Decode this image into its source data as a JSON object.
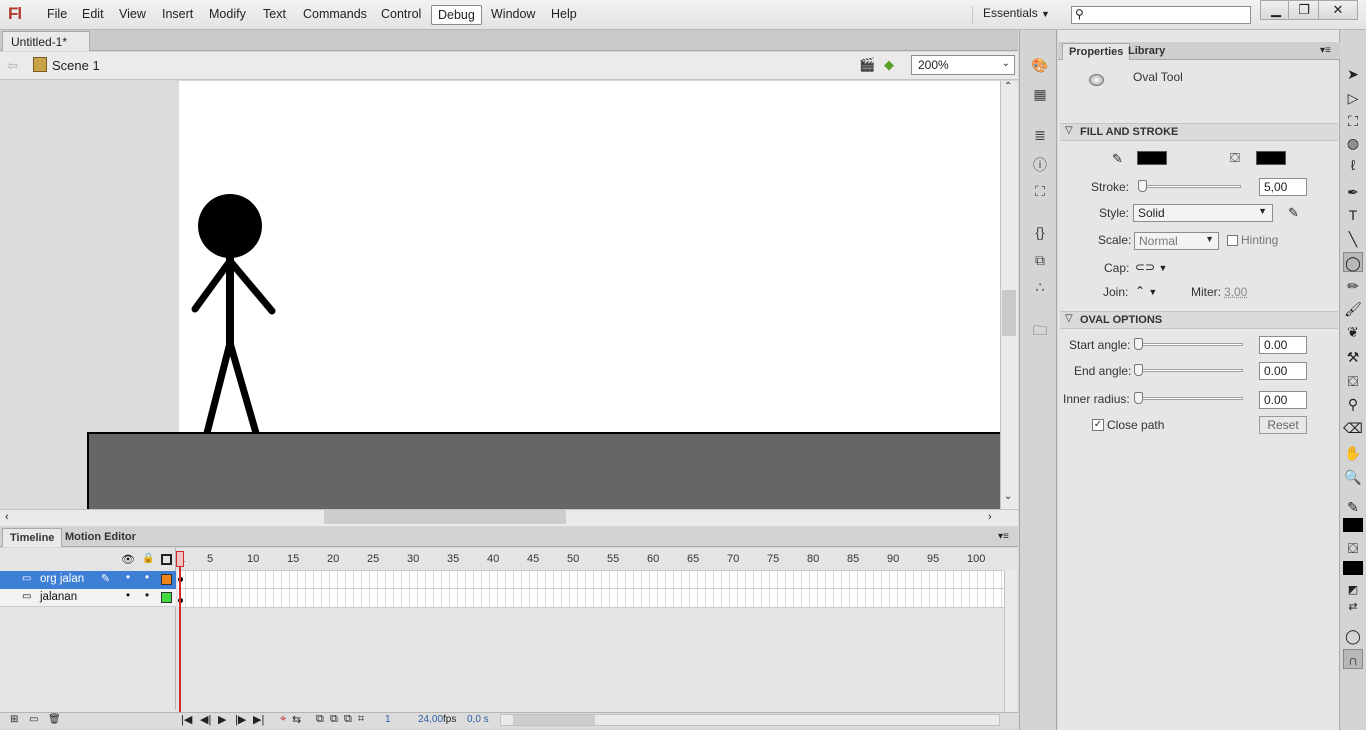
{
  "app": {
    "logo": "Fl"
  },
  "menu": [
    "File",
    "Edit",
    "View",
    "Insert",
    "Modify",
    "Text",
    "Commands",
    "Control",
    "Debug",
    "Window",
    "Help"
  ],
  "workspace": {
    "label": "Essentials"
  },
  "window_controls": {
    "minimize": "▁",
    "restore": "❐",
    "close": "✕"
  },
  "document": {
    "tab_title": "Untitled-1*",
    "scene": "Scene 1",
    "zoom": "200%"
  },
  "timeline": {
    "tabs": [
      "Timeline",
      "Motion Editor"
    ],
    "layers": [
      {
        "name": "org jalan",
        "color": "#f0861a",
        "selected": true
      },
      {
        "name": "jalanan",
        "color": "#3fdc3f",
        "selected": false
      }
    ],
    "ruler": [
      "1",
      "5",
      "10",
      "15",
      "20",
      "25",
      "30",
      "35",
      "40",
      "45",
      "50",
      "55",
      "60",
      "65",
      "70",
      "75",
      "80",
      "85",
      "90",
      "95",
      "100"
    ],
    "status": {
      "frame": "1",
      "fps": "24,00",
      "fps_unit": "fps",
      "time": "0,0 s"
    }
  },
  "properties": {
    "tabs": [
      "Properties",
      "Library"
    ],
    "tool_name": "Oval Tool",
    "fill_stroke": {
      "header": "FILL AND STROKE",
      "stroke_label": "Stroke:",
      "stroke_value": "5,00",
      "style_label": "Style:",
      "style_value": "Solid",
      "scale_label": "Scale:",
      "scale_value": "Normal",
      "hinting_label": "Hinting",
      "cap_label": "Cap:",
      "join_label": "Join:",
      "miter_label": "Miter:",
      "miter_value": "3,00",
      "stroke_color": "#000000",
      "fill_color": "#000000"
    },
    "oval_options": {
      "header": "OVAL OPTIONS",
      "start_label": "Start angle:",
      "start_value": "0.00",
      "end_label": "End angle:",
      "end_value": "0.00",
      "inner_label": "Inner radius:",
      "inner_value": "0.00",
      "close_path_label": "Close path",
      "reset_label": "Reset"
    }
  }
}
